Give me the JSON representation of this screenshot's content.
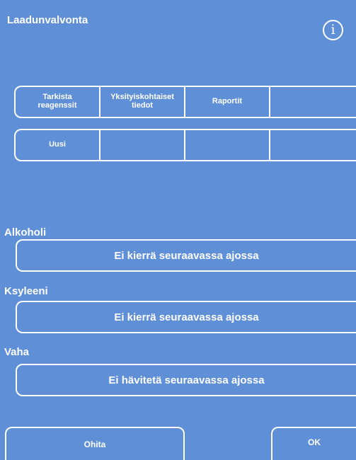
{
  "header": {
    "title": "Laadunvalvonta",
    "info_icon": "info-icon",
    "info_glyph": "i"
  },
  "tabs": {
    "row1": [
      {
        "label": "Tarkista\nreagenssit"
      },
      {
        "label": "Yksityiskohtaiset\ntiedot"
      },
      {
        "label": "Raportit"
      },
      {
        "label": ""
      }
    ],
    "row2": [
      {
        "label": "Uusi"
      },
      {
        "label": ""
      },
      {
        "label": ""
      },
      {
        "label": ""
      }
    ]
  },
  "sections": [
    {
      "label": "Alkoholi",
      "button": "Ei kierrä seuraavassa ajossa"
    },
    {
      "label": "Ksyleeni",
      "button": "Ei kierrä seuraavassa ajossa"
    },
    {
      "label": "Vaha",
      "button": "Ei hävitetä seuraavassa ajossa"
    }
  ],
  "footer": {
    "skip_label": "Ohita",
    "ok_label": "OK"
  },
  "colors": {
    "background": "#5f8fd6",
    "foreground": "#ffffff"
  }
}
